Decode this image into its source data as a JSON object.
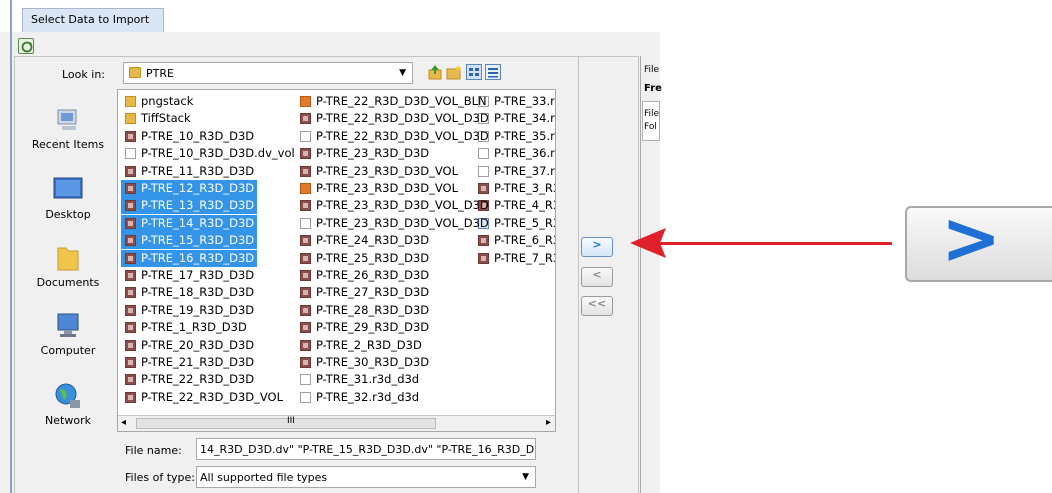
{
  "tab_label": "Select Data to Import",
  "look_in": {
    "label": "Look in:",
    "value": "PTRE"
  },
  "sidebar": [
    {
      "label": "Recent Items",
      "icon": "recent-items-icon"
    },
    {
      "label": "Desktop",
      "icon": "desktop-icon"
    },
    {
      "label": "Documents",
      "icon": "documents-folder-icon"
    },
    {
      "label": "Computer",
      "icon": "computer-icon"
    },
    {
      "label": "Network",
      "icon": "network-icon"
    }
  ],
  "files": {
    "col1": [
      {
        "name": "pngstack",
        "type": "folder"
      },
      {
        "name": "TiffStack",
        "type": "folder"
      },
      {
        "name": "P-TRE_10_R3D_D3D",
        "type": "dv"
      },
      {
        "name": "P-TRE_10_R3D_D3D.dv_vol",
        "type": "blank"
      },
      {
        "name": "P-TRE_11_R3D_D3D",
        "type": "dv"
      },
      {
        "name": "P-TRE_12_R3D_D3D",
        "type": "dv",
        "selected": true
      },
      {
        "name": "P-TRE_13_R3D_D3D",
        "type": "dv",
        "selected": true
      },
      {
        "name": "P-TRE_14_R3D_D3D",
        "type": "dv",
        "selected": true
      },
      {
        "name": "P-TRE_15_R3D_D3D",
        "type": "dv",
        "selected": true
      },
      {
        "name": "P-TRE_16_R3D_D3D",
        "type": "dv",
        "selected": true
      },
      {
        "name": "P-TRE_17_R3D_D3D",
        "type": "dv"
      },
      {
        "name": "P-TRE_18_R3D_D3D",
        "type": "dv"
      },
      {
        "name": "P-TRE_19_R3D_D3D",
        "type": "dv"
      },
      {
        "name": "P-TRE_1_R3D_D3D",
        "type": "dv"
      },
      {
        "name": "P-TRE_20_R3D_D3D",
        "type": "dv"
      },
      {
        "name": "P-TRE_21_R3D_D3D",
        "type": "dv"
      },
      {
        "name": "P-TRE_22_R3D_D3D",
        "type": "dv"
      },
      {
        "name": "P-TRE_22_R3D_D3D_VOL",
        "type": "dv"
      }
    ],
    "col2": [
      {
        "name": "P-TRE_22_R3D_D3D_VOL_BLN",
        "type": "bln"
      },
      {
        "name": "P-TRE_22_R3D_D3D_VOL_D3D",
        "type": "dv"
      },
      {
        "name": "P-TRE_22_R3D_D3D_VOL_D3D",
        "type": "blank"
      },
      {
        "name": "P-TRE_23_R3D_D3D",
        "type": "dv"
      },
      {
        "name": "P-TRE_23_R3D_D3D_VOL",
        "type": "dv"
      },
      {
        "name": "P-TRE_23_R3D_D3D_VOL",
        "type": "bln"
      },
      {
        "name": "P-TRE_23_R3D_D3D_VOL_D3D",
        "type": "dv"
      },
      {
        "name": "P-TRE_23_R3D_D3D_VOL_D3D",
        "type": "blank"
      },
      {
        "name": "P-TRE_24_R3D_D3D",
        "type": "dv"
      },
      {
        "name": "P-TRE_25_R3D_D3D",
        "type": "dv"
      },
      {
        "name": "P-TRE_26_R3D_D3D",
        "type": "dv"
      },
      {
        "name": "P-TRE_27_R3D_D3D",
        "type": "dv"
      },
      {
        "name": "P-TRE_28_R3D_D3D",
        "type": "dv"
      },
      {
        "name": "P-TRE_29_R3D_D3D",
        "type": "dv"
      },
      {
        "name": "P-TRE_2_R3D_D3D",
        "type": "dv"
      },
      {
        "name": "P-TRE_30_R3D_D3D",
        "type": "dv"
      },
      {
        "name": "P-TRE_31.r3d_d3d",
        "type": "blank"
      },
      {
        "name": "P-TRE_32.r3d_d3d",
        "type": "blank"
      }
    ],
    "col3": [
      {
        "name": "P-TRE_33.r3d_",
        "type": "blank"
      },
      {
        "name": "P-TRE_34.r3d_",
        "type": "blank"
      },
      {
        "name": "P-TRE_35.r3d_",
        "type": "blank"
      },
      {
        "name": "P-TRE_36.r3d_",
        "type": "blank"
      },
      {
        "name": "P-TRE_37.r3d_",
        "type": "blank"
      },
      {
        "name": "P-TRE_3_R3D_",
        "type": "dv"
      },
      {
        "name": "P-TRE_4_R3D_",
        "type": "dv"
      },
      {
        "name": "P-TRE_5_R3D_",
        "type": "img"
      },
      {
        "name": "P-TRE_6_R3D_",
        "type": "dv"
      },
      {
        "name": "P-TRE_7_R3D_",
        "type": "dv"
      }
    ]
  },
  "file_name": {
    "label": "File name:",
    "value": "14_R3D_D3D.dv\" \"P-TRE_15_R3D_D3D.dv\" \"P-TRE_16_R3D_D3D.dv\""
  },
  "file_type": {
    "label": "Files of type:",
    "value": "All supported file types"
  },
  "buttons": {
    "add": ">",
    "remove": "<",
    "remove_all": "<<"
  },
  "right_panel": {
    "header": "File",
    "bold": "Fre",
    "row1": "File",
    "row2": "Fol"
  },
  "scroll_grip": "III",
  "zoom_symbol": ">",
  "colors": {
    "selection": "#3394e8",
    "arrow": "#e0202a",
    "accent_blue": "#1e6fd6"
  }
}
